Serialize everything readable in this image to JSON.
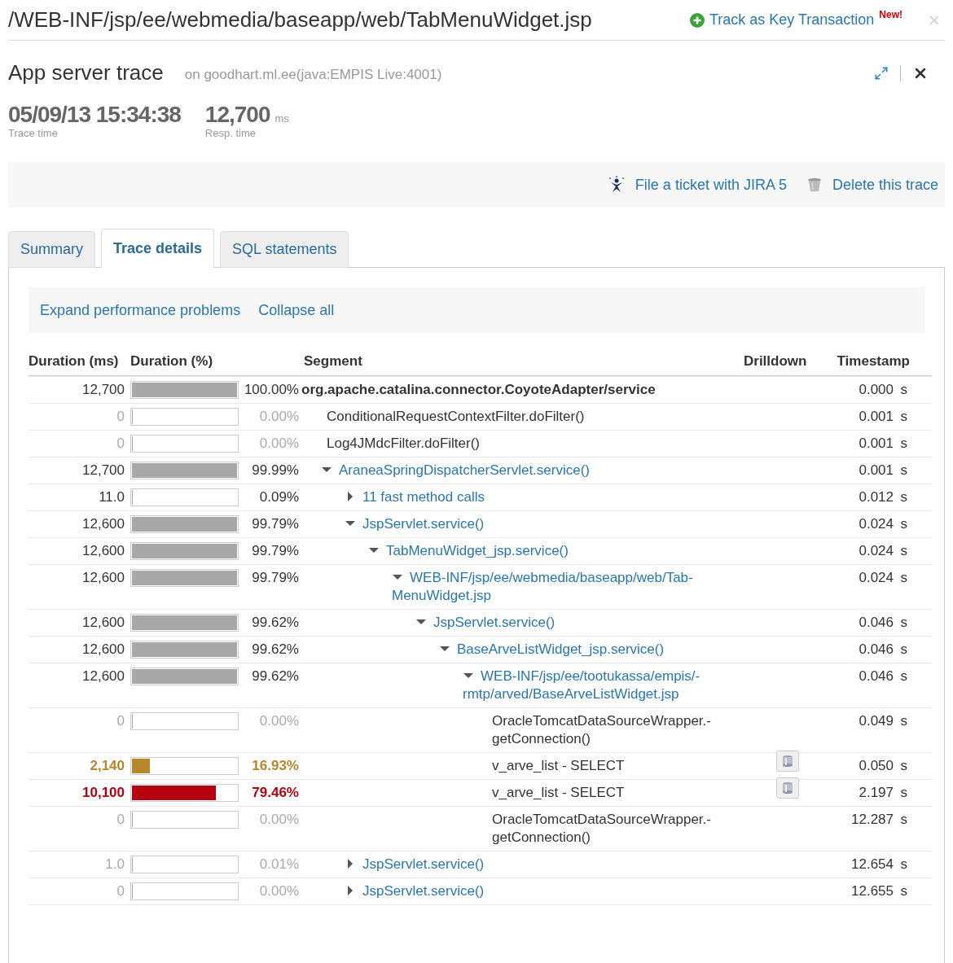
{
  "path_title": "/WEB-INF/jsp/ee/webmedia/baseapp/web/TabMenuWidget.jsp",
  "track_link": {
    "label": "Track as Key Transaction",
    "badge": "New!"
  },
  "trace": {
    "title": "App server trace",
    "host": "on goodhart.ml.ee(java:EMPIS Live:4001)"
  },
  "stats": [
    {
      "value": "05/09/13 15:34:38",
      "label": "Trace time"
    },
    {
      "value": "12,700",
      "unit": "ms",
      "label": "Resp. time"
    }
  ],
  "actions": [
    {
      "label": "File a ticket with JIRA 5",
      "kind": "jira"
    },
    {
      "label": "Delete this trace",
      "kind": "delete"
    }
  ],
  "tabs": [
    {
      "label": "Summary",
      "selected": false
    },
    {
      "label": "Trace details",
      "selected": true
    },
    {
      "label": "SQL statements",
      "selected": false
    }
  ],
  "tree_actions": [
    "Expand performance problems",
    "Collapse all"
  ],
  "table": {
    "columns": [
      "Duration (ms)",
      "Duration (%)",
      "Segment",
      "Drilldown",
      "Timestamp"
    ],
    "rows": [
      {
        "duration": "12,700",
        "level": 1,
        "percent": "100.00%",
        "segment": "org.apache.catalina.connector.CoyoteAdapter/service",
        "bold": true,
        "link": false,
        "kind": "normal",
        "drilldown": false,
        "timestamp": "0.000",
        "unit": "s",
        "children": [
          {
            "duration": "0",
            "level": 0,
            "percent": "0.00%",
            "segment": "ConditionalRequestContextFilter.doFilter()",
            "bold": false,
            "link": false,
            "kind": "minor",
            "drilldown": false,
            "timestamp": "0.001",
            "unit": "s"
          },
          {
            "duration": "0",
            "level": 0,
            "percent": "0.00%",
            "segment": "Log4JMdcFilter.doFilter()",
            "bold": false,
            "link": false,
            "kind": "minor",
            "drilldown": false,
            "timestamp": "0.001",
            "unit": "s"
          },
          {
            "duration": "12,700",
            "level": 0.9999,
            "percent": "99.99%",
            "segment": "AraneaSpringDispatcherServlet.service()",
            "bold": false,
            "link": true,
            "expanded": true,
            "kind": "normal",
            "drilldown": false,
            "timestamp": "0.001",
            "unit": "s",
            "children": [
              {
                "duration": "11.0",
                "level": 0.0009,
                "percent": "0.09%",
                "segment": "11 fast method calls",
                "bold": false,
                "link": true,
                "expanded": false,
                "kind": "normal",
                "drilldown": false,
                "timestamp": "0.012",
                "unit": "s"
              },
              {
                "duration": "12,600",
                "level": 0.9979,
                "percent": "99.79%",
                "segment": "JspServlet.service()",
                "bold": false,
                "link": true,
                "expanded": true,
                "kind": "normal",
                "drilldown": false,
                "timestamp": "0.024",
                "unit": "s",
                "children": [
                  {
                    "duration": "12,600",
                    "level": 0.9979,
                    "percent": "99.79%",
                    "segment": "TabMenuWidget_jsp.service()",
                    "bold": false,
                    "link": true,
                    "expanded": true,
                    "kind": "normal",
                    "drilldown": false,
                    "timestamp": "0.024",
                    "unit": "s",
                    "children": [
                      {
                        "duration": "12,600",
                        "level": 0.9979,
                        "percent": "99.79%",
                        "segment": "WEB-INF/jsp/ee/webmedia/baseapp/web/Tab-MenuWidget.jsp",
                        "bold": false,
                        "link": true,
                        "expanded": true,
                        "kind": "normal",
                        "drilldown": false,
                        "timestamp": "0.024",
                        "unit": "s",
                        "children": [
                          {
                            "duration": "12,600",
                            "level": 0.9962,
                            "percent": "99.62%",
                            "segment": "JspServlet.service()",
                            "bold": false,
                            "link": true,
                            "expanded": true,
                            "kind": "normal",
                            "drilldown": false,
                            "timestamp": "0.046",
                            "unit": "s",
                            "children": [
                              {
                                "duration": "12,600",
                                "level": 0.9962,
                                "percent": "99.62%",
                                "segment": "BaseArveListWidget_jsp.service()",
                                "bold": false,
                                "link": true,
                                "expanded": true,
                                "kind": "normal",
                                "drilldown": false,
                                "timestamp": "0.046",
                                "unit": "s",
                                "children": [
                                  {
                                    "duration": "12,600",
                                    "level": 0.9962,
                                    "percent": "99.62%",
                                    "segment": "WEB-INF/jsp/ee/tootukassa/empis/-rmtp/arved/BaseArveListWidget.jsp",
                                    "bold": false,
                                    "link": true,
                                    "expanded": true,
                                    "kind": "normal",
                                    "drilldown": false,
                                    "timestamp": "0.046",
                                    "unit": "s",
                                    "children": [
                                      {
                                        "duration": "0",
                                        "level": 0,
                                        "percent": "0.00%",
                                        "segment": "OracleTomcatDataSourceWrapper.-getConnection()",
                                        "bold": false,
                                        "link": false,
                                        "kind": "minor",
                                        "drilldown": false,
                                        "timestamp": "0.049",
                                        "unit": "s"
                                      },
                                      {
                                        "duration": "2,140",
                                        "level": 0.1693,
                                        "percent": "16.93%",
                                        "segment": "v_arve_list - SELECT",
                                        "bold": false,
                                        "link": false,
                                        "kind": "warning",
                                        "drilldown": true,
                                        "timestamp": "0.050",
                                        "unit": "s"
                                      },
                                      {
                                        "duration": "10,100",
                                        "level": 0.7946,
                                        "percent": "79.46%",
                                        "segment": "v_arve_list - SELECT",
                                        "bold": false,
                                        "link": false,
                                        "kind": "critical",
                                        "drilldown": true,
                                        "timestamp": "2.197",
                                        "unit": "s"
                                      },
                                      {
                                        "duration": "0",
                                        "level": 0,
                                        "percent": "0.00%",
                                        "segment": "OracleTomcatDataSourceWrapper.-getConnection()",
                                        "bold": false,
                                        "link": false,
                                        "kind": "minor",
                                        "drilldown": false,
                                        "timestamp": "12.287",
                                        "unit": "s"
                                      }
                                    ]
                                  }
                                ]
                              }
                            ]
                          }
                        ]
                      }
                    ]
                  }
                ]
              },
              {
                "duration": "1.0",
                "level": 0.0001,
                "percent": "0.01%",
                "segment": "JspServlet.service()",
                "bold": false,
                "link": true,
                "expanded": false,
                "kind": "minor",
                "drilldown": false,
                "timestamp": "12.654",
                "unit": "s"
              },
              {
                "duration": "0",
                "level": 0,
                "percent": "0.00%",
                "segment": "JspServlet.service()",
                "bold": false,
                "link": true,
                "expanded": false,
                "kind": "minor",
                "drilldown": false,
                "timestamp": "12.655",
                "unit": "s"
              }
            ]
          }
        ]
      }
    ]
  }
}
